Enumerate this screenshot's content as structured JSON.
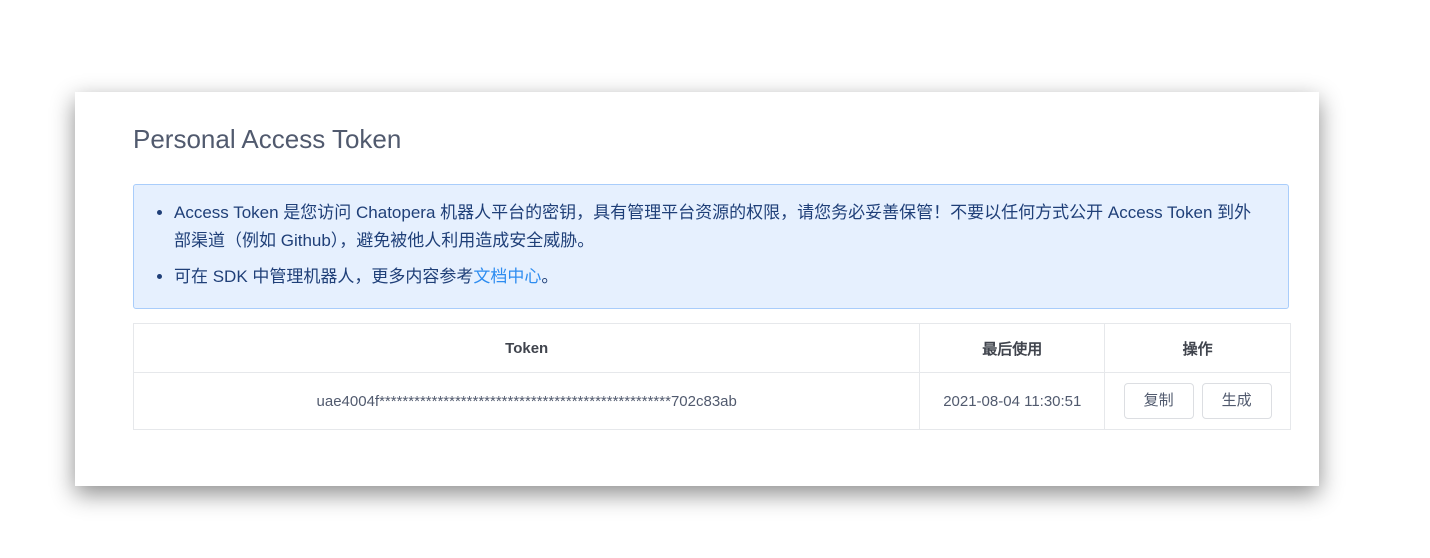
{
  "title": "Personal Access Token",
  "alert": {
    "item1": "Access Token 是您访问 Chatopera 机器人平台的密钥，具有管理平台资源的权限，请您务必妥善保管！不要以任何方式公开 Access Token 到外部渠道（例如 Github），避免被他人利用造成安全威胁。",
    "item2_prefix": "可在 SDK 中管理机器人，更多内容参考",
    "item2_link": "文档中心",
    "item2_suffix": "。"
  },
  "table": {
    "headers": [
      "Token",
      "最后使用",
      "操作"
    ],
    "rows": [
      {
        "token": "uae4004f**************************************************702c83ab",
        "last_used": "2021-08-04 11:30:51",
        "copy_label": "复制",
        "generate_label": "生成"
      }
    ]
  }
}
